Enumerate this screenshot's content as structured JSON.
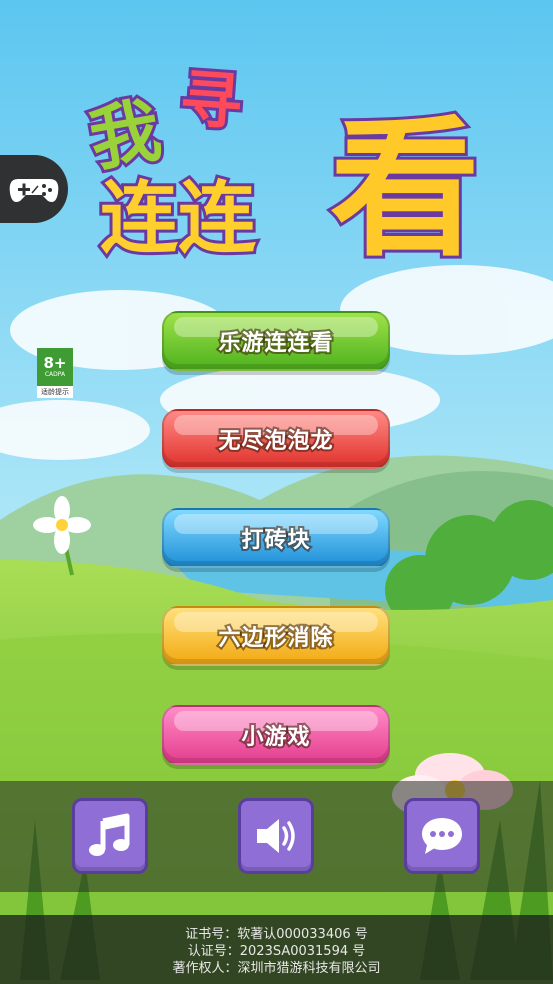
{
  "title": {
    "line1_a": "我",
    "line1_b": "寻",
    "line2": "连连",
    "big": "看"
  },
  "age_rating": {
    "age": "8+",
    "org": "CADPA",
    "tip": "适龄提示"
  },
  "menu": [
    {
      "label": "乐游连连看"
    },
    {
      "label": "无尽泡泡龙"
    },
    {
      "label": "打砖块"
    },
    {
      "label": "六边形消除"
    },
    {
      "label": "小游戏"
    }
  ],
  "toolbar": {
    "music_icon": "music-note-icon",
    "sound_icon": "speaker-icon",
    "chat_icon": "chat-bubble-icon"
  },
  "footer": {
    "line1": "证书号：软著认000033406 号",
    "line2": "认证号：2023SA0031594 号",
    "line3": "著作权人：深圳市猎游科技有限公司"
  },
  "colors": {
    "sky": "#7fd3f2",
    "grass": "#7cc53a",
    "button_green": "#4eb21e",
    "button_red": "#e0322c",
    "button_blue": "#1f8fd8",
    "button_yellow": "#f2a912",
    "button_pink": "#e43d8d",
    "tool_purple": "#8f6fd6"
  }
}
